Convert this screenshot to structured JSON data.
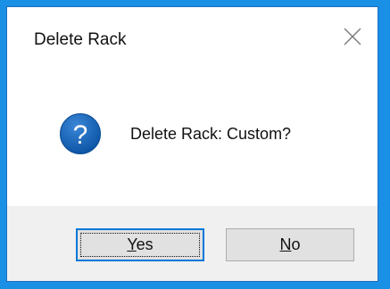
{
  "dialog": {
    "title": "Delete Rack",
    "message": "Delete Rack: Custom?",
    "icon": "question-icon",
    "close_icon": "close-icon"
  },
  "buttons": {
    "yes": {
      "mnemonic": "Y",
      "rest": "es",
      "default": true
    },
    "no": {
      "mnemonic": "N",
      "rest": "o",
      "default": false
    }
  },
  "colors": {
    "desktop": "#1a8fe6",
    "accent": "#0078d7",
    "icon_fill": "#1565c0",
    "footer_bg": "#f0f0f0"
  }
}
